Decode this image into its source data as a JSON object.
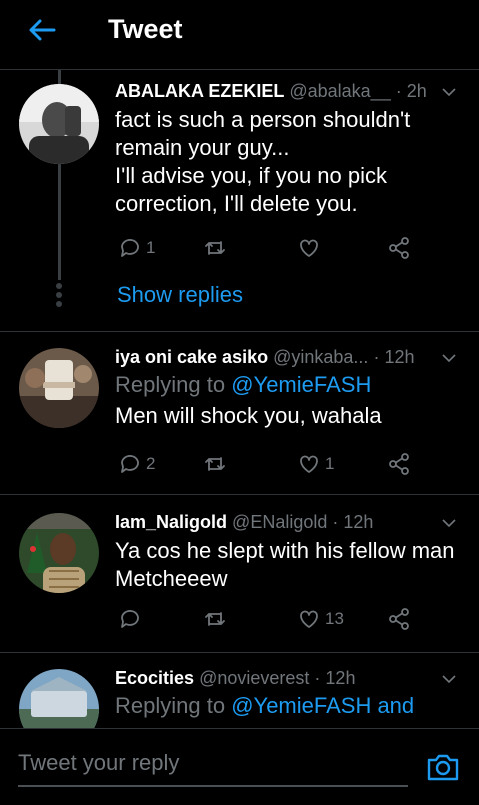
{
  "header": {
    "title": "Tweet",
    "back_icon": "arrow-left-icon",
    "accent": "#1d9bf0"
  },
  "tweets": [
    {
      "name": "ABALAKA EZEKIEL",
      "handle": "@abalaka__",
      "dot": "·",
      "time": "2h",
      "replying_prefix": "",
      "replying_to": "",
      "text_lines": [
        "fact is such a person shouldn't",
        "remain your guy...",
        "I'll advise you, if you no pick",
        "correction, I'll delete you."
      ],
      "replies": "1",
      "retweets": "",
      "likes": "",
      "show_replies": "Show replies"
    },
    {
      "name": "iya oni cake asiko",
      "handle": "@yinkaba...",
      "dot": "·",
      "time": "12h",
      "replying_prefix": "Replying to",
      "replying_to": "@YemieFASH",
      "text_lines": [
        "Men will shock you, wahala"
      ],
      "replies": "2",
      "retweets": "",
      "likes": "1"
    },
    {
      "name": "Iam_Naligold",
      "handle": "@ENaligold",
      "dot": "·",
      "time": "12h",
      "text_lines": [
        "Ya cos he slept with his fellow man",
        "Metcheeew"
      ],
      "replies": "",
      "retweets": "",
      "likes": "13"
    },
    {
      "name": "Ecocities",
      "handle": "@novieverest",
      "dot": "·",
      "time": "12h",
      "replying_prefix": "Replying to",
      "replying_to": "@YemieFASH and"
    }
  ],
  "compose": {
    "placeholder": "Tweet your reply",
    "camera_icon": "camera-icon"
  }
}
